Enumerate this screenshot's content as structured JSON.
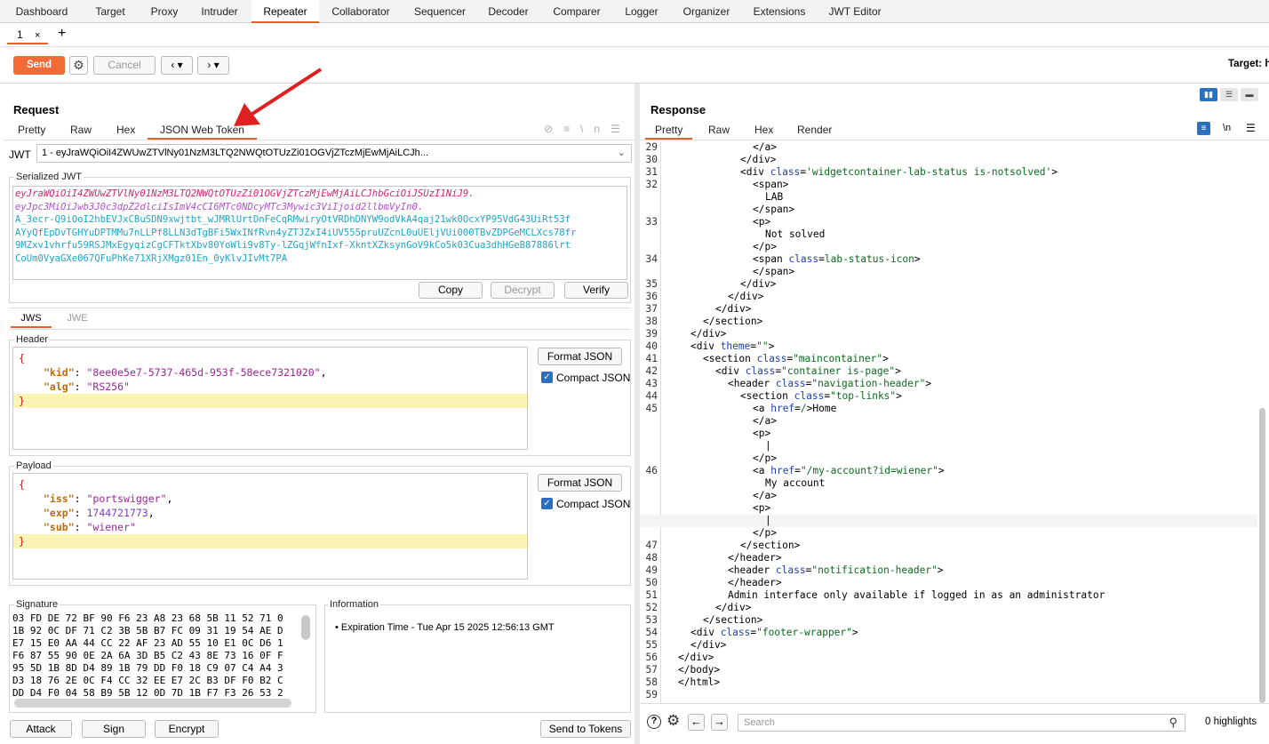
{
  "top_tabs": [
    "Dashboard",
    "Target",
    "Proxy",
    "Intruder",
    "Repeater",
    "Collaborator",
    "Sequencer",
    "Decoder",
    "Comparer",
    "Logger",
    "Organizer",
    "Extensions",
    "JWT Editor"
  ],
  "sub_tab": {
    "label": "1",
    "close": "×",
    "add": "+"
  },
  "toolbar": {
    "send": "Send",
    "cancel": "Cancel",
    "target": "Target: h"
  },
  "request": {
    "title": "Request",
    "tabs": [
      "Pretty",
      "Raw",
      "Hex",
      "JSON Web Token"
    ],
    "jwt_label": "JWT",
    "jwt_select": "1 - eyJraWQiOiI4ZWUwZTVlNy01NzM3LTQ2NWQtOTUzZi01OGVjZTczMjEwMjAiLCJh...",
    "serialized_label": "Serialized JWT",
    "serialized": {
      "header": "eyJraWQiOiI4ZWUwZTVlNy01NzM3LTQ2NWQtOTUzZi01OGVjZTczMjEwMjAiLCJhbGciOiJSUzI1NiJ9.",
      "payload": "eyJpc3MiOiJwb3J0c3dpZ2dlciIsImV4cCI6MTc0NDcyMTc3Mywic3ViIjoid2llbmVyIn0.",
      "sig": [
        "A_3ecr-Q9iOoI2hbEVJxCBuSDN9xwjtbt_wJMRlUrtDnFeCqRMwiryOtVRDhDNYW9odVkA4qaj21wk0OcxYP95VdG43UiRt53f",
        "AYyQfEpDvTGHYuDPTMMu7nLLPf8LLN3dTgBFi5WxINfRvn4yZTJZxI4iUV555pruUZcnL0uUEljVUi000TBvZDPGeMCLXcs78fr",
        "9MZxv1vhrfu59RSJMxEgyqizCgCFTktXbv80YoWli9v8Ty-lZGqjWfnIxf-XkntXZksynGoV9kCo5k03Cua3dhHGeB87886lrt",
        "CoUm0VyaGXe067QFuPhKe71XRjXMgz01En_0yKlvJIvMt7PA"
      ]
    },
    "serialized_buttons": [
      "Copy",
      "Decrypt",
      "Verify"
    ],
    "jws_tabs": [
      "JWS",
      "JWE"
    ],
    "header_label": "Header",
    "header_json": [
      {
        "t": "{"
      },
      {
        "k": "\"kid\"",
        "v": "\"8ee0e5e7-5737-465d-953f-58ece7321020\"",
        "c": ","
      },
      {
        "k": "\"alg\"",
        "v": "\"RS256\"",
        "c": ""
      },
      {
        "t": "}"
      }
    ],
    "payload_label": "Payload",
    "payload_json": [
      {
        "t": "{"
      },
      {
        "k": "\"iss\"",
        "v": "\"portswigger\"",
        "c": ","
      },
      {
        "k": "\"exp\"",
        "v": "1744721773",
        "c": ","
      },
      {
        "k": "\"sub\"",
        "v": "\"wiener\"",
        "c": ""
      },
      {
        "t": "}"
      }
    ],
    "format_json": "Format JSON",
    "compact_json": "Compact JSON",
    "signature_label": "Signature",
    "signature_hex": [
      "03 FD DE 72 BF 90 F6 23 A8 23 68 5B 11 52 71 0",
      "1B 92 0C DF 71 C2 3B 5B B7 FC 09 31 19 54 AE D",
      "E7 15 E0 AA 44 CC 22 AF 23 AD 55 10 E1 0C D6 1",
      "F6 87 55 90 0E 2A 6A 3D B5 C2 43 8E 73 16 0F F",
      "95 5D 1B 8D D4 89 1B 79 DD F0 18 C9 07 C4 A4 3",
      "D3 18 76 2E 0C F4 CC 32 EE E7 2C B3 DF F0 B2 C",
      "DD D4 F0 04 58 B9 5B 12 0D 7D 1B F7 F3 26 53 2"
    ],
    "information_label": "Information",
    "information": "• Expiration Time - Tue Apr 15 2025 12:56:13 GMT",
    "bottom_buttons": [
      "Attack",
      "Sign",
      "Encrypt",
      "Send to Tokens"
    ]
  },
  "response": {
    "title": "Response",
    "tabs": [
      "Pretty",
      "Raw",
      "Hex",
      "Render"
    ],
    "lines": [
      {
        "n": "29",
        "i": 6,
        "parts": [
          [
            "tg",
            "</a>"
          ]
        ]
      },
      {
        "n": "30",
        "i": 5,
        "parts": [
          [
            "tg",
            "</div>"
          ]
        ]
      },
      {
        "n": "31",
        "i": 5,
        "parts": [
          [
            "tg",
            "<div "
          ],
          [
            "an",
            "class"
          ],
          [
            "tg",
            "="
          ],
          [
            "av",
            "'widgetcontainer-lab-status is-notsolved'"
          ],
          [
            "tg",
            ">"
          ]
        ]
      },
      {
        "n": "32",
        "i": 6,
        "parts": [
          [
            "tg",
            "<span>"
          ]
        ]
      },
      {
        "n": "",
        "i": 7,
        "parts": [
          [
            "tg",
            "LAB"
          ]
        ]
      },
      {
        "n": "",
        "i": 6,
        "parts": [
          [
            "tg",
            "</span>"
          ]
        ]
      },
      {
        "n": "33",
        "i": 6,
        "parts": [
          [
            "tg",
            "<p>"
          ]
        ]
      },
      {
        "n": "",
        "i": 7,
        "parts": [
          [
            "tg",
            "Not solved"
          ]
        ]
      },
      {
        "n": "",
        "i": 6,
        "parts": [
          [
            "tg",
            "</p>"
          ]
        ]
      },
      {
        "n": "34",
        "i": 6,
        "parts": [
          [
            "tg",
            "<span "
          ],
          [
            "an",
            "class"
          ],
          [
            "tg",
            "="
          ],
          [
            "av",
            "lab-status-icon"
          ],
          [
            "tg",
            ">"
          ]
        ]
      },
      {
        "n": "",
        "i": 6,
        "parts": [
          [
            "tg",
            "</span>"
          ]
        ]
      },
      {
        "n": "35",
        "i": 5,
        "parts": [
          [
            "tg",
            "</div>"
          ]
        ]
      },
      {
        "n": "36",
        "i": 4,
        "parts": [
          [
            "tg",
            "</div>"
          ]
        ]
      },
      {
        "n": "37",
        "i": 3,
        "parts": [
          [
            "tg",
            "</div>"
          ]
        ]
      },
      {
        "n": "38",
        "i": 2,
        "parts": [
          [
            "tg",
            "</section>"
          ]
        ]
      },
      {
        "n": "39",
        "i": 1,
        "parts": [
          [
            "tg",
            "</div>"
          ]
        ]
      },
      {
        "n": "40",
        "i": 1,
        "parts": [
          [
            "tg",
            "<div "
          ],
          [
            "an",
            "theme"
          ],
          [
            "tg",
            "="
          ],
          [
            "av",
            "\"\""
          ],
          [
            "tg",
            ">"
          ]
        ]
      },
      {
        "n": "41",
        "i": 2,
        "parts": [
          [
            "tg",
            "<section "
          ],
          [
            "an",
            "class"
          ],
          [
            "tg",
            "="
          ],
          [
            "av",
            "\"maincontainer\""
          ],
          [
            "tg",
            ">"
          ]
        ]
      },
      {
        "n": "42",
        "i": 3,
        "parts": [
          [
            "tg",
            "<div "
          ],
          [
            "an",
            "class"
          ],
          [
            "tg",
            "="
          ],
          [
            "av",
            "\"container is-page\""
          ],
          [
            "tg",
            ">"
          ]
        ]
      },
      {
        "n": "43",
        "i": 4,
        "parts": [
          [
            "tg",
            "<header "
          ],
          [
            "an",
            "class"
          ],
          [
            "tg",
            "="
          ],
          [
            "av",
            "\"navigation-header\""
          ],
          [
            "tg",
            ">"
          ]
        ]
      },
      {
        "n": "44",
        "i": 5,
        "parts": [
          [
            "tg",
            "<section "
          ],
          [
            "an",
            "class"
          ],
          [
            "tg",
            "="
          ],
          [
            "av",
            "\"top-links\""
          ],
          [
            "tg",
            ">"
          ]
        ]
      },
      {
        "n": "45",
        "i": 6,
        "parts": [
          [
            "tg",
            "<a "
          ],
          [
            "an",
            "href"
          ],
          [
            "tg",
            "="
          ],
          [
            "av",
            "/"
          ],
          [
            "tg",
            ">Home"
          ]
        ]
      },
      {
        "n": "",
        "i": 6,
        "parts": [
          [
            "tg",
            "</a>"
          ]
        ]
      },
      {
        "n": "",
        "i": 6,
        "parts": [
          [
            "tg",
            "<p>"
          ]
        ]
      },
      {
        "n": "",
        "i": 7,
        "parts": [
          [
            "tg",
            "|"
          ]
        ]
      },
      {
        "n": "",
        "i": 6,
        "parts": [
          [
            "tg",
            "</p>"
          ]
        ]
      },
      {
        "n": "46",
        "i": 6,
        "parts": [
          [
            "tg",
            "<a "
          ],
          [
            "an",
            "href"
          ],
          [
            "tg",
            "="
          ],
          [
            "av",
            "\"/my-account?id=wiener\""
          ],
          [
            "tg",
            ">"
          ]
        ]
      },
      {
        "n": "",
        "i": 7,
        "parts": [
          [
            "tg",
            "My account"
          ]
        ]
      },
      {
        "n": "",
        "i": 6,
        "parts": [
          [
            "tg",
            "</a>"
          ]
        ]
      },
      {
        "n": "",
        "i": 6,
        "parts": [
          [
            "tg",
            "<p>"
          ]
        ]
      },
      {
        "n": "",
        "i": 7,
        "parts": [
          [
            "tg",
            "|"
          ]
        ]
      },
      {
        "n": "",
        "i": 6,
        "parts": [
          [
            "tg",
            "</p>"
          ]
        ]
      },
      {
        "n": "47",
        "i": 5,
        "parts": [
          [
            "tg",
            "</section>"
          ]
        ]
      },
      {
        "n": "48",
        "i": 4,
        "parts": [
          [
            "tg",
            "</header>"
          ]
        ]
      },
      {
        "n": "49",
        "i": 4,
        "parts": [
          [
            "tg",
            "<header "
          ],
          [
            "an",
            "class"
          ],
          [
            "tg",
            "="
          ],
          [
            "av",
            "\"notification-header\""
          ],
          [
            "tg",
            ">"
          ]
        ]
      },
      {
        "n": "50",
        "i": 4,
        "parts": [
          [
            "tg",
            "</header>"
          ]
        ]
      },
      {
        "n": "51",
        "i": 4,
        "parts": [
          [
            "tg",
            "Admin interface only available if logged in as an administrator"
          ]
        ]
      },
      {
        "n": "52",
        "i": 3,
        "parts": [
          [
            "tg",
            "</div>"
          ]
        ]
      },
      {
        "n": "53",
        "i": 2,
        "parts": [
          [
            "tg",
            "</section>"
          ]
        ]
      },
      {
        "n": "54",
        "i": 1,
        "parts": [
          [
            "tg",
            "<div "
          ],
          [
            "an",
            "class"
          ],
          [
            "tg",
            "="
          ],
          [
            "av",
            "\"footer-wrapper\""
          ],
          [
            "tg",
            ">"
          ]
        ]
      },
      {
        "n": "55",
        "i": 1,
        "parts": [
          [
            "tg",
            "</div>"
          ]
        ]
      },
      {
        "n": "56",
        "i": 0,
        "parts": [
          [
            "tg",
            "</div>"
          ]
        ]
      },
      {
        "n": "57",
        "i": 0,
        "parts": [
          [
            "tg",
            "</body>"
          ]
        ]
      },
      {
        "n": "58",
        "i": 0,
        "parts": [
          [
            "tg",
            "</html>"
          ]
        ]
      },
      {
        "n": "59",
        "i": 0,
        "parts": []
      }
    ],
    "search_placeholder": "Search",
    "highlights": "0 highlights"
  },
  "colors": {
    "accent": "#e8602c",
    "send": "#f26a35",
    "jwt_header": "#d6246e",
    "jwt_payload": "#b44fd1",
    "jwt_sig": "#1fa6c9"
  }
}
